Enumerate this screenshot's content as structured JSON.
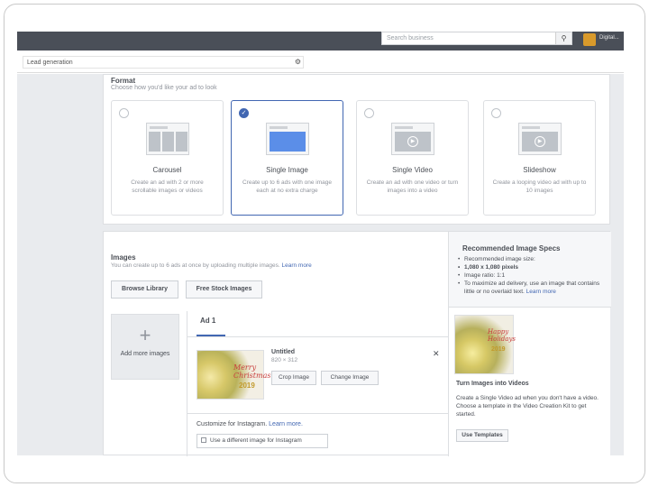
{
  "topbar": {
    "search_placeholder": "Search business",
    "search_icon": "search-icon",
    "user_name": "Digital..."
  },
  "campaign": {
    "value": "Lead generation",
    "icon": "gear-icon"
  },
  "format": {
    "title": "Format",
    "subtitle": "Choose how you'd like your ad to look",
    "options": [
      {
        "name": "Carousel",
        "desc": "Create an ad with 2 or more scrollable images or videos",
        "selected": false
      },
      {
        "name": "Single Image",
        "desc": "Create up to 6 ads with one image each at no extra charge",
        "selected": true
      },
      {
        "name": "Single Video",
        "desc": "Create an ad with one video or turn images into a video",
        "selected": false
      },
      {
        "name": "Slideshow",
        "desc": "Create a looping video ad with up to 10 images",
        "selected": false
      }
    ]
  },
  "images": {
    "title": "Images",
    "subtitle": "You can create up to 6 ads at once by uploading multiple images.",
    "learn_more": "Learn more",
    "browse_label": "Browse Library",
    "stock_label": "Free Stock Images",
    "add_more_label": "Add more images",
    "ad_tab": "Ad 1",
    "file_name": "Untitled",
    "file_size": "820 × 312",
    "crop_label": "Crop Image",
    "change_label": "Change Image",
    "thumb_text1": "Merry Christmas",
    "thumb_text2": "2019",
    "customize_label": "Customize for Instagram.",
    "customize_link": "Learn more.",
    "instagram_option": "Use a different image for Instagram"
  },
  "specs": {
    "title": "Recommended Image Specs",
    "items": [
      "Recommended image size:",
      "1,080 x 1,080 pixels",
      "Image ratio: 1:1",
      "To maximize ad delivery, use an image that contains little or no overlaid text."
    ],
    "learn_more": "Learn more"
  },
  "video_promo": {
    "title": "Turn Images into Videos",
    "text": "Create a Single Video ad when you don't have a video. Choose a template in the Video Creation Kit to get started.",
    "button": "Use Templates",
    "img_text1": "Happy Holidays",
    "img_text2": "2019"
  },
  "colors": {
    "accent": "#4267b2",
    "topbar": "#4a4f58",
    "page_bg": "#e9ebee"
  }
}
